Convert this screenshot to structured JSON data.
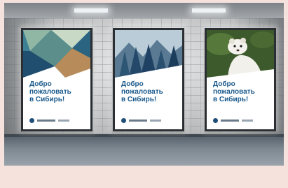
{
  "posters": [
    {
      "theme": "geometric-landscape",
      "accent": "#1a5a8c",
      "lines": [
        "Добро",
        "пожаловать",
        "в Сибирь!"
      ]
    },
    {
      "theme": "forest",
      "accent": "#1a5a8c",
      "lines": [
        "Добро",
        "пожаловать",
        "в Сибирь!"
      ]
    },
    {
      "theme": "ermine",
      "accent": "#1a5a8c",
      "lines": [
        "Добро",
        "пожаловать",
        "в Сибирь!"
      ]
    }
  ],
  "colors": {
    "page_background": "#f5e2dc",
    "poster_text": "#1a5a8c",
    "frame": "#2b2f33"
  }
}
